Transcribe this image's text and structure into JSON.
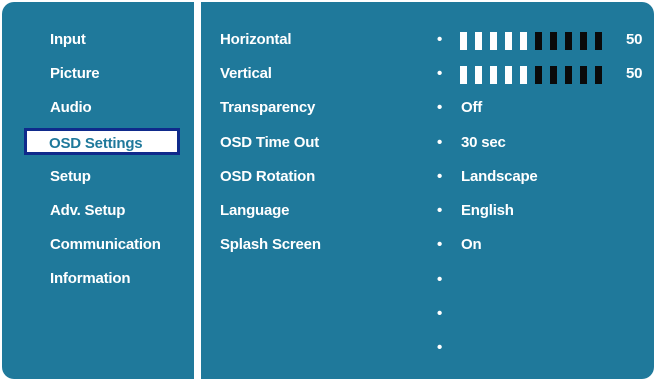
{
  "menu": {
    "items": [
      {
        "label": "Input"
      },
      {
        "label": "Picture"
      },
      {
        "label": "Audio"
      },
      {
        "label": "OSD Settings",
        "selected": true
      },
      {
        "label": "Setup"
      },
      {
        "label": "Adv. Setup"
      },
      {
        "label": "Communication"
      },
      {
        "label": "Information"
      }
    ]
  },
  "settings": {
    "horizontal": {
      "label": "Horizontal",
      "value": "50",
      "level": 0.5
    },
    "vertical": {
      "label": "Vertical",
      "value": "50",
      "level": 0.5
    },
    "transparency": {
      "label": "Transparency",
      "value": "Off"
    },
    "osd_time_out": {
      "label": "OSD Time Out",
      "value": "30 sec"
    },
    "osd_rotation": {
      "label": "OSD Rotation",
      "value": "Landscape"
    },
    "language": {
      "label": "Language",
      "value": "English"
    },
    "splash_screen": {
      "label": "Splash Screen",
      "value": "On"
    },
    "bullet": "•"
  },
  "colors": {
    "panel": "#1f799b",
    "selection_border": "#0f2a8b",
    "slider_on": "#ffffff",
    "slider_off": "#0a0a0a"
  }
}
